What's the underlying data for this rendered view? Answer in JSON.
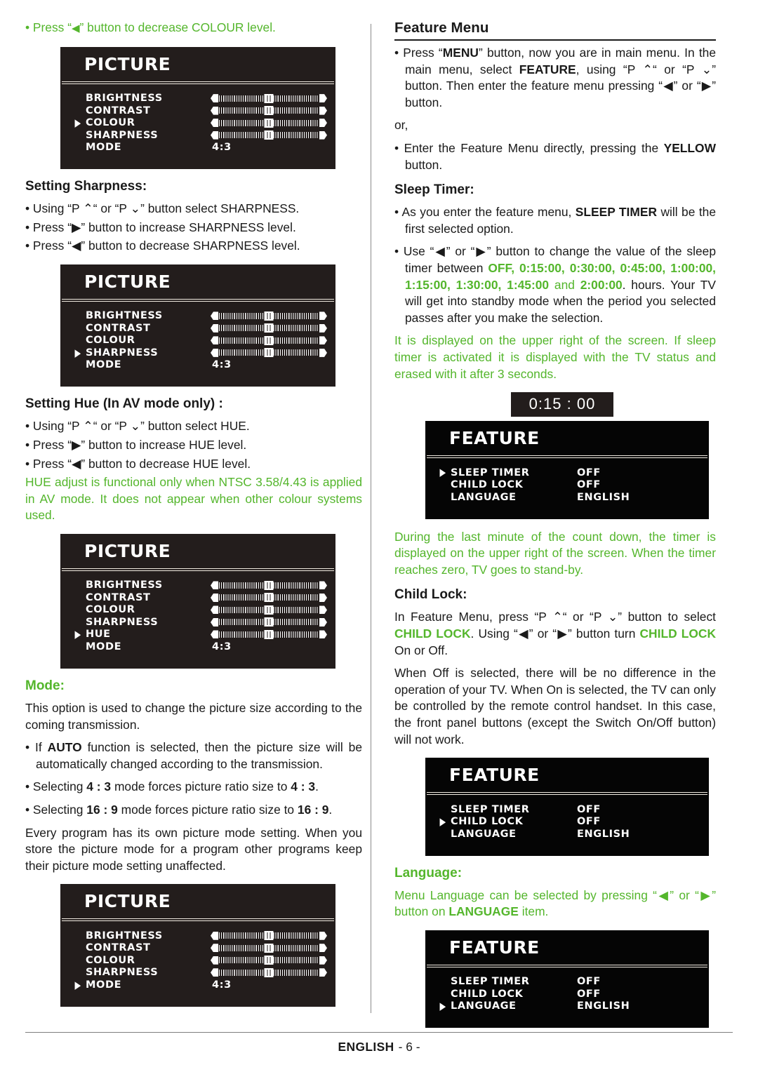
{
  "meta": {
    "accent_green": "#54b62c",
    "osd_background": "#231d1c",
    "osd_text": "#ffffff"
  },
  "left_column": {
    "intro_bullet": {
      "prefix": "• Press “",
      "icon": "◀",
      "suffix": "” button to decrease COLOUR level."
    },
    "picture_menu_1": {
      "title": "PICTURE",
      "cursor_index": 2,
      "rows": [
        {
          "label": "BRIGHTNESS",
          "type": "slider",
          "value": 50
        },
        {
          "label": "CONTRAST",
          "type": "slider",
          "value": 50
        },
        {
          "label": "COLOUR",
          "type": "slider",
          "value": 50
        },
        {
          "label": "SHARPNESS",
          "type": "slider",
          "value": 50
        },
        {
          "label": "MODE",
          "type": "value",
          "value": "4:3"
        }
      ]
    },
    "sharpness_heading": "Setting Sharpness:",
    "sharpness_bullets": [
      "• Using “P ⌃“ or “P ⌄” button select SHARPNESS.",
      "• Press “▶” button to increase SHARPNESS level.",
      "• Press “◀” button to decrease SHARPNESS level."
    ],
    "picture_menu_2": {
      "title": "PICTURE",
      "cursor_index": 3,
      "rows": [
        {
          "label": "BRIGHTNESS",
          "type": "slider",
          "value": 50
        },
        {
          "label": "CONTRAST",
          "type": "slider",
          "value": 50
        },
        {
          "label": "COLOUR",
          "type": "slider",
          "value": 50
        },
        {
          "label": "SHARPNESS",
          "type": "slider",
          "value": 50
        },
        {
          "label": "MODE",
          "type": "value",
          "value": "4:3"
        }
      ]
    },
    "hue_heading": "Setting Hue (In AV mode only) :",
    "hue_bullets": [
      "• Using “P ⌃“ or “P ⌄” button select HUE.",
      "• Press “▶” button to increase HUE level.",
      "• Press “◀” button to decrease HUE level."
    ],
    "hue_note": "HUE adjust is functional only when NTSC 3.58/4.43 is applied in AV mode. It does not appear when other colour systems used.",
    "picture_menu_3": {
      "title": "PICTURE",
      "cursor_index": 4,
      "rows": [
        {
          "label": "BRIGHTNESS",
          "type": "slider",
          "value": 50
        },
        {
          "label": "CONTRAST",
          "type": "slider",
          "value": 50
        },
        {
          "label": "COLOUR",
          "type": "slider",
          "value": 50
        },
        {
          "label": "SHARPNESS",
          "type": "slider",
          "value": 50
        },
        {
          "label": "HUE",
          "type": "slider",
          "value": 50
        },
        {
          "label": "MODE",
          "type": "value",
          "value": "4:3"
        }
      ]
    },
    "mode_heading": "Mode:",
    "mode_intro": "This option is used to change the picture size according to the coming transmission.",
    "mode_bullet_auto_pre": "• If ",
    "mode_bullet_auto_bold": "AUTO",
    "mode_bullet_auto_post": " function is selected, then the picture size will be automatically changed according to the transmission.",
    "mode_bullet_43_pre": "• Selecting ",
    "mode_bullet_43_b1": "4 : 3",
    "mode_bullet_43_mid": " mode forces picture ratio size to ",
    "mode_bullet_43_b2": "4 : 3",
    "mode_bullet_43_end": ".",
    "mode_bullet_169_pre": "• Selecting ",
    "mode_bullet_169_b1": "16 : 9",
    "mode_bullet_169_mid": " mode forces picture ratio size to ",
    "mode_bullet_169_b2": "16 : 9",
    "mode_bullet_169_end": ".",
    "mode_outro": "Every program has its own picture mode setting. When you store the picture mode for a program other programs keep their picture mode setting unaffected.",
    "picture_menu_4": {
      "title": "PICTURE",
      "cursor_index": 4,
      "rows": [
        {
          "label": "BRIGHTNESS",
          "type": "slider",
          "value": 50
        },
        {
          "label": "CONTRAST",
          "type": "slider",
          "value": 50
        },
        {
          "label": "COLOUR",
          "type": "slider",
          "value": 50
        },
        {
          "label": "SHARPNESS",
          "type": "slider",
          "value": 50
        },
        {
          "label": "MODE",
          "type": "value",
          "value": "4:3"
        }
      ]
    }
  },
  "right_column": {
    "feature_heading": "Feature Menu",
    "menu_bullet_p1": "• Press “",
    "menu_bullet_menu": "MENU",
    "menu_bullet_p2": "” button, now you are in main menu. In the main menu, select ",
    "menu_bullet_feature": "FEATURE",
    "menu_bullet_p3": ", using “P ⌃“ or “P ⌄” button. Then enter the feature menu pressing “◀” or “▶” button.",
    "or_text": "or,",
    "yellow_bullet_p1": "• Enter the Feature Menu directly, pressing the ",
    "yellow_bullet_bold": "YELLOW",
    "yellow_bullet_p2": " button.",
    "sleep_timer_heading": "Sleep Timer:",
    "sleep_bullet1_p1": "• As you enter the feature menu, ",
    "sleep_bullet1_bold": "SLEEP TIMER",
    "sleep_bullet1_p2": " will be the first selected option.",
    "sleep_bullet2_p1": "• Use “◀” or “▶” button to change the value of the sleep timer between ",
    "sleep_values_1": "OFF, 0:15:00, 0:30:00, 0:45:00, 1:00:00, 1:15:00, 1:30:00, 1:45:00",
    "sleep_and": " and ",
    "sleep_values_2": "2:00:00",
    "sleep_bullet2_p2": ". hours. Your TV will get into standby mode when the period you selected passes after you make the selection.",
    "sleep_note": "It is displayed on the upper right of the screen. If sleep timer is activated it is displayed with the TV status and erased with it after 3 seconds.",
    "timer_readout": "0:15 : 00",
    "feature_menu_1": {
      "title": "FEATURE",
      "cursor_index": 0,
      "rows": [
        {
          "label": "SLEEP TIMER",
          "value": "OFF"
        },
        {
          "label": "CHILD LOCK",
          "value": "OFF"
        },
        {
          "label": "LANGUAGE",
          "value": "ENGLISH"
        }
      ]
    },
    "countdown_note": "During the last minute of the count down, the timer is displayed on the upper right of the screen. When the timer reaches zero, TV goes to stand-by.",
    "child_lock_heading": "Child Lock:",
    "child_lock_p1": "In Feature Menu, press “P ⌃“ or “P ⌄” button to select ",
    "child_lock_g1": "CHILD LOCK",
    "child_lock_p2": ". Using “◀” or “▶” button turn ",
    "child_lock_g2": "CHILD LOCK",
    "child_lock_p3": " On or Off.",
    "child_lock_body": "When Off is selected, there will be no difference in the operation of your TV. When On is selected, the TV can only be controlled by the remote control handset. In this case, the front panel buttons (except the Switch On/Off button) will not work.",
    "feature_menu_2": {
      "title": "FEATURE",
      "cursor_index": 1,
      "rows": [
        {
          "label": "SLEEP TIMER",
          "value": "OFF"
        },
        {
          "label": "CHILD LOCK",
          "value": "OFF"
        },
        {
          "label": "LANGUAGE",
          "value": "ENGLISH"
        }
      ]
    },
    "language_heading": "Language:",
    "language_p1": "Menu Language can be selected by pressing “◀” or “▶” button on ",
    "language_bold": "LANGUAGE",
    "language_p2": " item.",
    "feature_menu_3": {
      "title": "FEATURE",
      "cursor_index": 2,
      "rows": [
        {
          "label": "SLEEP TIMER",
          "value": "OFF"
        },
        {
          "label": "CHILD LOCK",
          "value": "OFF"
        },
        {
          "label": "LANGUAGE",
          "value": "ENGLISH"
        }
      ]
    }
  },
  "footer": {
    "language": "ENGLISH",
    "page": "- 6 -"
  }
}
